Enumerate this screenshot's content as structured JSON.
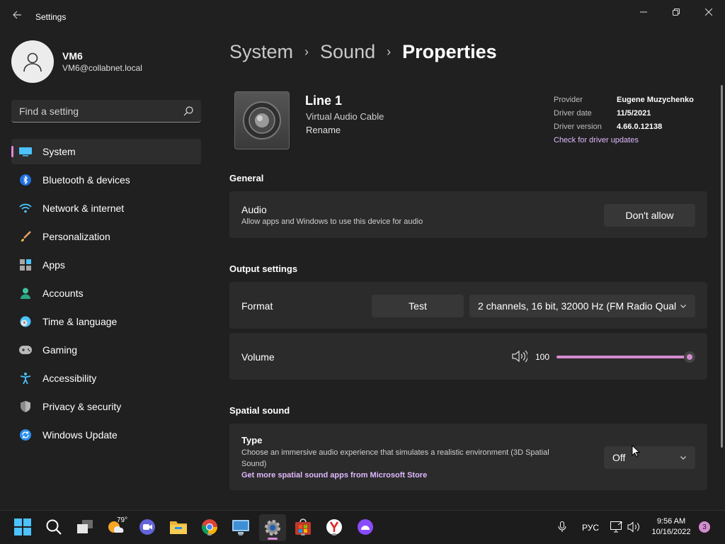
{
  "window": {
    "title": "Settings"
  },
  "profile": {
    "name": "VM6",
    "email": "VM6@collabnet.local"
  },
  "search": {
    "placeholder": "Find a setting"
  },
  "sidebar": {
    "items": [
      {
        "label": "System",
        "icon": "system-icon",
        "active": true
      },
      {
        "label": "Bluetooth & devices",
        "icon": "bluetooth-icon"
      },
      {
        "label": "Network & internet",
        "icon": "wifi-icon"
      },
      {
        "label": "Personalization",
        "icon": "brush-icon"
      },
      {
        "label": "Apps",
        "icon": "apps-icon"
      },
      {
        "label": "Accounts",
        "icon": "accounts-icon"
      },
      {
        "label": "Time & language",
        "icon": "clock-globe-icon"
      },
      {
        "label": "Gaming",
        "icon": "gamepad-icon"
      },
      {
        "label": "Accessibility",
        "icon": "accessibility-icon"
      },
      {
        "label": "Privacy & security",
        "icon": "shield-icon"
      },
      {
        "label": "Windows Update",
        "icon": "update-icon"
      }
    ]
  },
  "breadcrumb": {
    "part1": "System",
    "part2": "Sound",
    "current": "Properties"
  },
  "device": {
    "name": "Line 1",
    "type": "Virtual Audio Cable",
    "rename": "Rename",
    "provider_label": "Provider",
    "provider": "Eugene Muzychenko",
    "date_label": "Driver date",
    "date": "11/5/2021",
    "version_label": "Driver version",
    "version": "4.66.0.12138",
    "update_link": "Check for driver updates"
  },
  "general": {
    "section": "General",
    "audio_title": "Audio",
    "audio_desc": "Allow apps and Windows to use this device for audio",
    "audio_button": "Don't allow"
  },
  "output": {
    "section": "Output settings",
    "format_label": "Format",
    "test_button": "Test",
    "format_value": "2 channels, 16 bit, 32000 Hz (FM Radio Qual",
    "volume_label": "Volume",
    "volume_value": "100",
    "volume_fraction": 1.0
  },
  "spatial": {
    "section": "Spatial sound",
    "type_label": "Type",
    "type_desc_1": "Choose an immersive audio experience that simulates a realistic environment (3D Spatial",
    "type_desc_2": "Sound)",
    "store_link": "Get more spatial sound apps from Microsoft Store",
    "type_value": "Off"
  },
  "taskbar": {
    "weather_temp": "79°",
    "language": "РУС",
    "time": "9:56 AM",
    "date": "10/16/2022",
    "notifications": "3"
  },
  "colors": {
    "accent": "#d48cd0",
    "background": "#202020",
    "card": "#2b2b2b"
  }
}
